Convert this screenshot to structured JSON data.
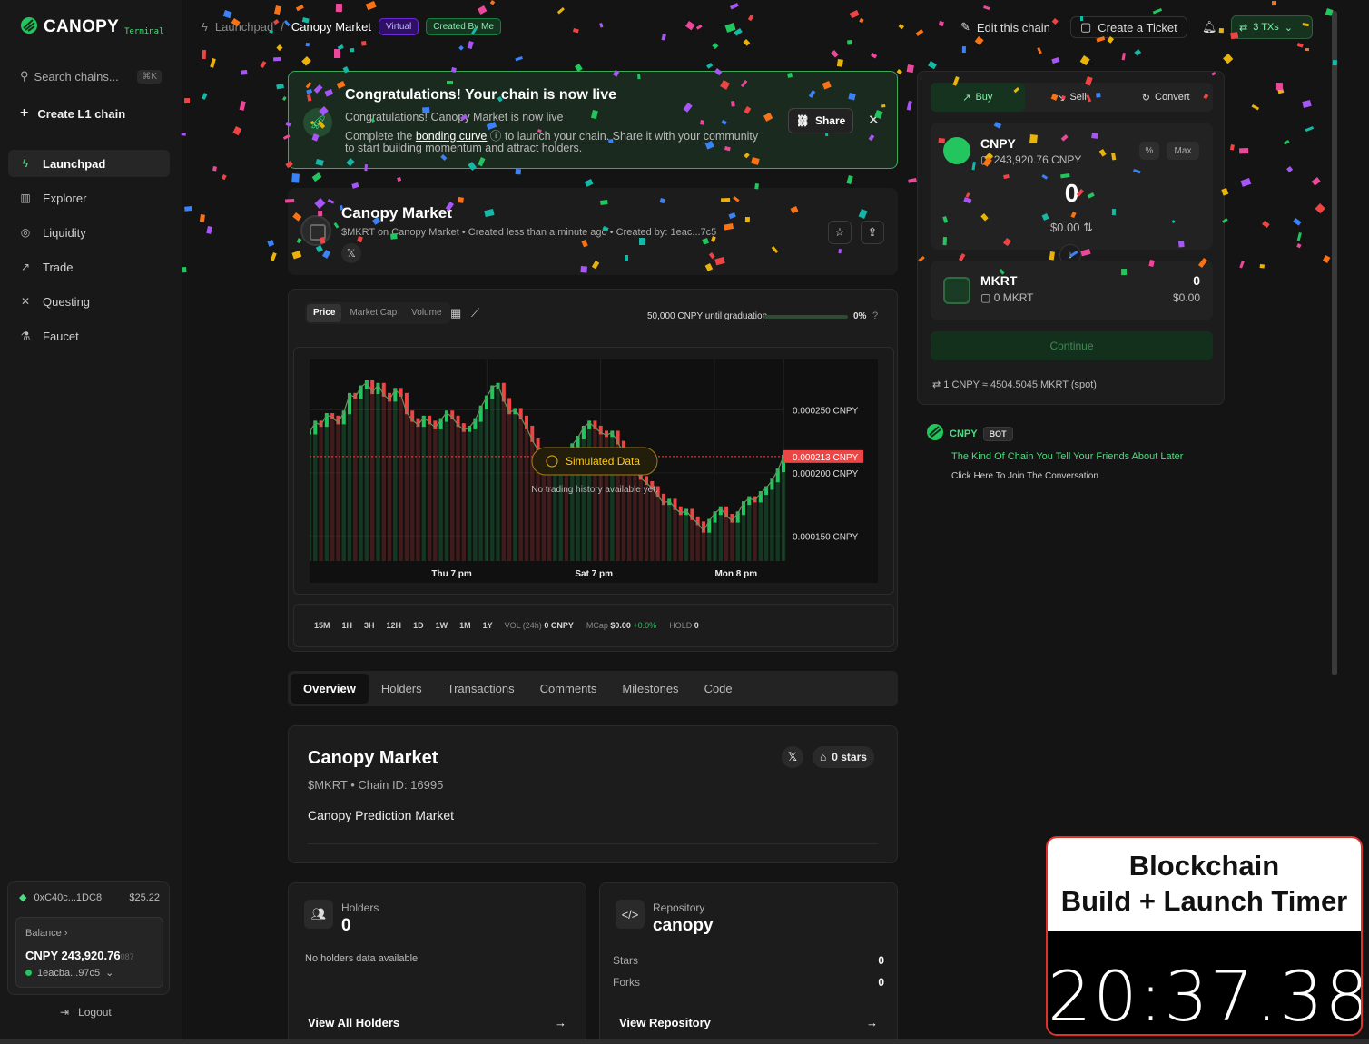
{
  "sidebar": {
    "brand": "CANOPY",
    "brand_sub": "Terminal",
    "search_placeholder": "Search chains...",
    "search_kbd": "⌘K",
    "create_label": "Create L1 chain",
    "nav": [
      {
        "label": "Launchpad",
        "icon": "rocket-icon",
        "active": true
      },
      {
        "label": "Explorer",
        "icon": "bar-chart-icon"
      },
      {
        "label": "Liquidity",
        "icon": "droplets-icon"
      },
      {
        "label": "Trade",
        "icon": "trend-icon"
      },
      {
        "label": "Questing",
        "icon": "quest-icon"
      },
      {
        "label": "Faucet",
        "icon": "flask-icon"
      }
    ],
    "wallet": {
      "address": "0xC40c...1DC8",
      "usd": "$25.22",
      "balance_label": "Balance",
      "balance_amount": "CNPY 243,920.76",
      "balance_fraction": "087",
      "account": "1eacba...97c5"
    },
    "logout_label": "Logout"
  },
  "topbar": {
    "crumb_parent": "Launchpad",
    "crumb_current": "Canopy Market",
    "badge_virtual": "Virtual",
    "badge_mine": "Created By Me",
    "edit_label": "Edit this chain",
    "ticket_label": "Create a Ticket",
    "txs_label": "3 TXs"
  },
  "banner": {
    "title": "Congratulations! Your chain is now live",
    "line1": "Congratulations! Canopy Market is now live",
    "line2_pre": "Complete the",
    "line2_link": "bonding curve",
    "line2_post": "to launch your chain. Share it with your community",
    "line3": "to start building momentum and attract holders.",
    "share_label": "Share"
  },
  "token": {
    "name": "Canopy Market",
    "meta": "$MKRT on Canopy Market • Created less than a minute ago • Created by: 1eac...7c5"
  },
  "chart_controls": {
    "modes": [
      "Price",
      "Market Cap",
      "Volume"
    ],
    "graduation_text": "50,000 CNPY until graduation",
    "graduation_pct": "0%",
    "graduation_fraction": 0,
    "timeframes": [
      "15M",
      "1H",
      "3H",
      "12H",
      "1D",
      "1W",
      "1M",
      "1Y"
    ],
    "vol_label": "VOL (24h)",
    "vol_value": "0 CNPY",
    "mcap_label": "MCap",
    "mcap_value": "$0.00",
    "mcap_change": "+0.0%",
    "hold_label": "HOLD",
    "hold_value": "0",
    "simulated_label": "Simulated Data",
    "no_history": "No trading history available yet."
  },
  "chart_data": {
    "type": "line",
    "x_labels": [
      "Thu 7 pm",
      "Sat 7 pm",
      "Mon 8 pm"
    ],
    "y_ticks": [
      "0.000250 CNPY",
      "0.000200 CNPY",
      "0.000150 CNPY"
    ],
    "y_tick_values": [
      0.00025,
      0.0002,
      0.00015
    ],
    "current_price_label": "0.000213 CNPY",
    "current_price": 0.000213,
    "ylim": [
      0.00013,
      0.00029
    ],
    "series": [
      {
        "values": [
          0.000232,
          0.00024,
          0.000238,
          0.000246,
          0.000244,
          0.00024,
          0.000248,
          0.000262,
          0.00026,
          0.000268,
          0.000272,
          0.000264,
          0.00027,
          0.000262,
          0.000258,
          0.000266,
          0.000262,
          0.000248,
          0.000242,
          0.000238,
          0.000244,
          0.00024,
          0.000236,
          0.000242,
          0.000248,
          0.000244,
          0.000238,
          0.000234,
          0.000236,
          0.000242,
          0.000252,
          0.00026,
          0.000268,
          0.00027,
          0.000258,
          0.000248,
          0.00025,
          0.000244,
          0.000236,
          0.000226,
          0.000218,
          0.00021,
          0.000206,
          0.000212,
          0.000216,
          0.000214,
          0.000222,
          0.000228,
          0.000236,
          0.00024,
          0.000236,
          0.000232,
          0.00023,
          0.000232,
          0.000224,
          0.000216,
          0.00021,
          0.000202,
          0.000196,
          0.000192,
          0.000188,
          0.000182,
          0.000176,
          0.000178,
          0.000172,
          0.000168,
          0.00017,
          0.000164,
          0.00016,
          0.000154,
          0.000162,
          0.000168,
          0.000172,
          0.000166,
          0.000162,
          0.000168,
          0.000176,
          0.00018,
          0.000178,
          0.000184,
          0.000188,
          0.000194,
          0.000202,
          0.000213
        ]
      }
    ]
  },
  "tabs": [
    "Overview",
    "Holders",
    "Transactions",
    "Comments",
    "Milestones",
    "Code"
  ],
  "overview": {
    "title": "Canopy Market",
    "meta": "$MKRT • Chain ID: 16995",
    "description": "Canopy Prediction Market",
    "stars": "0 stars"
  },
  "holders_card": {
    "label": "Holders",
    "value": "0",
    "empty": "No holders data available",
    "link": "View All Holders"
  },
  "repo_card": {
    "label": "Repository",
    "value": "canopy",
    "stars_label": "Stars",
    "stars_value": "0",
    "forks_label": "Forks",
    "forks_value": "0",
    "link": "View Repository"
  },
  "swap": {
    "tabs": [
      "Buy",
      "Sell",
      "Convert"
    ],
    "pay_token": "CNPY",
    "pay_balance": "243,920.76 CNPY",
    "pct_label": "%",
    "max_label": "Max",
    "amount": "0",
    "amount_usd": "$0.00",
    "recv_token": "MKRT",
    "recv_balance": "0 MKRT",
    "recv_amount": "0",
    "recv_usd": "$0.00",
    "continue_label": "Continue",
    "rate": "1 CNPY ≈ 4504.5045 MKRT (spot)"
  },
  "bot": {
    "name": "CNPY",
    "tag": "BOT",
    "line1": "The Kind Of Chain You Tell Your Friends About Later",
    "line2": "Click Here To Join The Conversation"
  },
  "timer": {
    "title_line1": "Blockchain",
    "title_line2": "Build + Launch Timer",
    "time": "20:37.38"
  },
  "colors": {
    "accent": "#4ade80",
    "accent_dark": "#16331f",
    "price_line": "#ef4444",
    "candle_up": "#22c55e",
    "candle_down": "#ef4444",
    "timer_border": "#e0312b"
  }
}
